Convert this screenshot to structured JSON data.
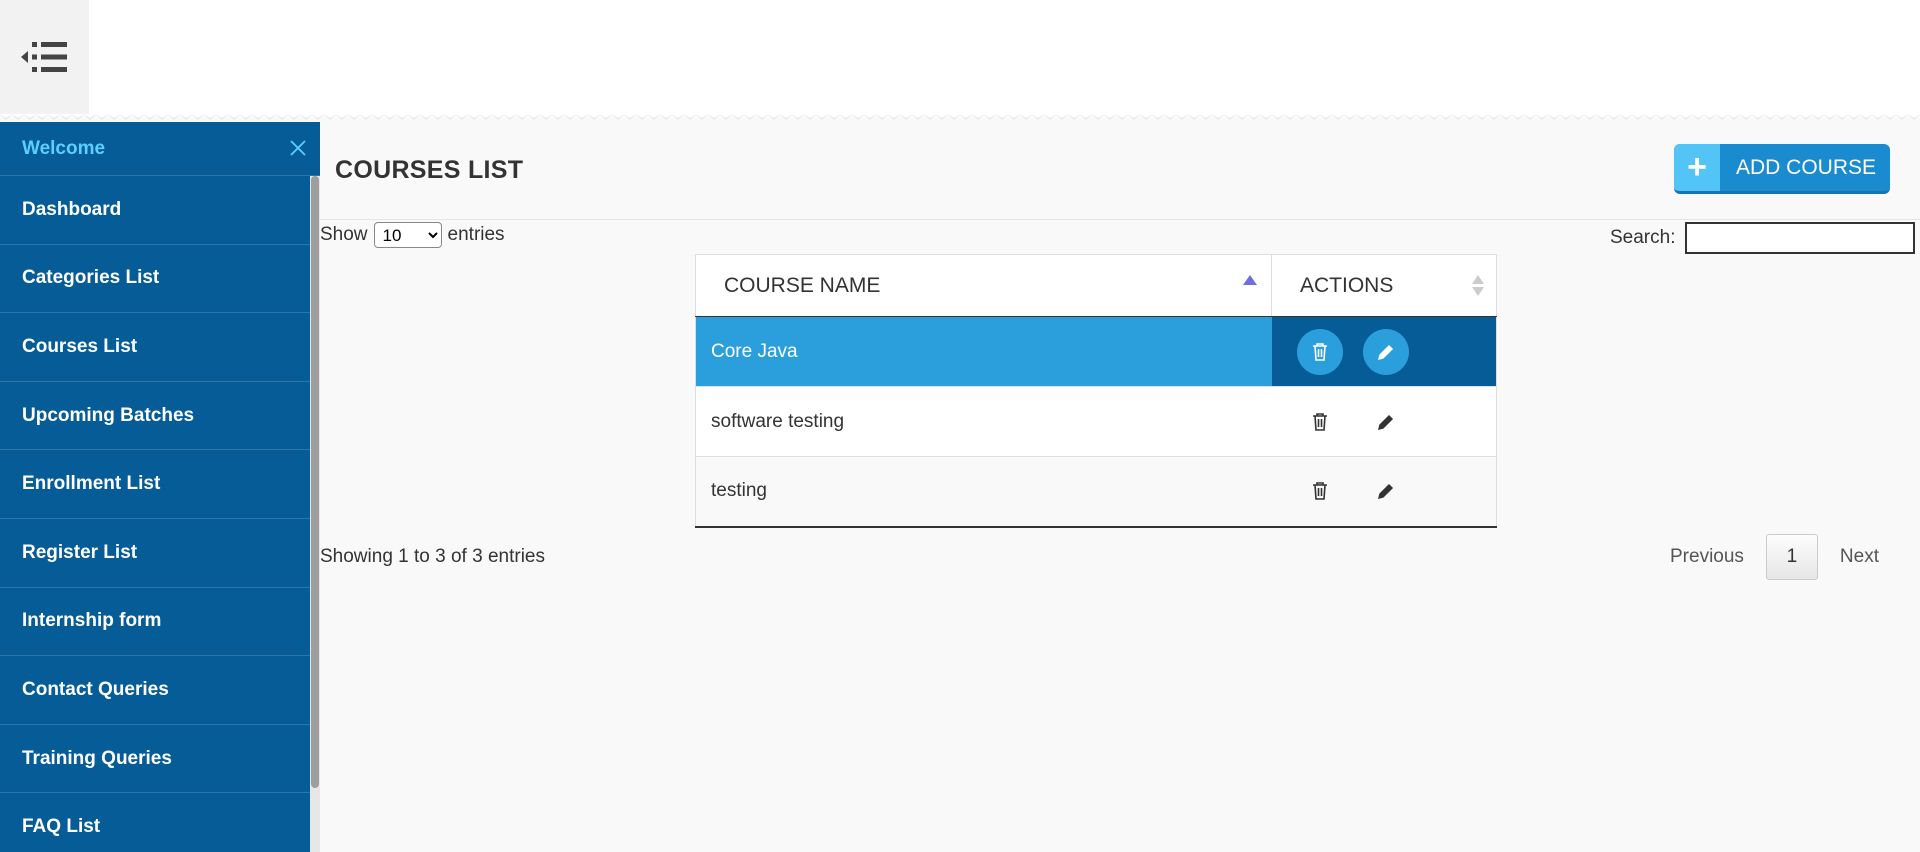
{
  "header": {
    "menu_icon": "menu-collapse-icon"
  },
  "sidebar": {
    "welcome": "Welcome",
    "close_icon": "close-icon",
    "items": [
      {
        "label": "Dashboard"
      },
      {
        "label": "Categories List"
      },
      {
        "label": "Courses List"
      },
      {
        "label": "Upcoming Batches"
      },
      {
        "label": "Enrollment List"
      },
      {
        "label": "Register List"
      },
      {
        "label": "Internship form"
      },
      {
        "label": "Contact Queries"
      },
      {
        "label": "Training Queries"
      },
      {
        "label": "FAQ List"
      }
    ]
  },
  "main": {
    "title": "COURSES LIST",
    "add_button": "ADD COURSE",
    "length": {
      "show": "Show",
      "value": "10",
      "entries": "entries",
      "options": [
        "10"
      ]
    },
    "search": {
      "label": "Search:",
      "value": ""
    },
    "table": {
      "columns": [
        "COURSE NAME",
        "ACTIONS"
      ],
      "rows": [
        {
          "name": "Core Java",
          "selected": true
        },
        {
          "name": "software testing",
          "selected": false
        },
        {
          "name": "testing",
          "selected": false
        }
      ]
    },
    "info": "Showing 1 to 3 of 3 entries",
    "pager": {
      "previous": "Previous",
      "current": "1",
      "next": "Next"
    }
  },
  "colors": {
    "sidebar": "#055c97",
    "accent": "#2b9fdc",
    "welcome": "#5ad0ff",
    "button": "#1b8bd0"
  }
}
